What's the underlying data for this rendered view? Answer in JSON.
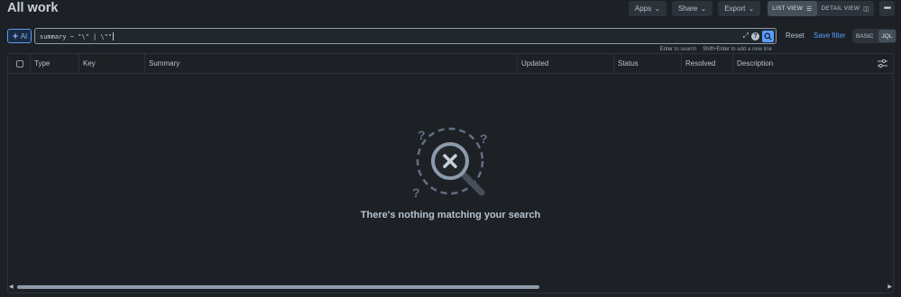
{
  "page": {
    "title": "All work"
  },
  "toolbar": {
    "apps": "Apps",
    "share": "Share",
    "export": "Export",
    "list_view": "LIST VIEW",
    "detail_view": "DETAIL VIEW",
    "more": "•••"
  },
  "search": {
    "ai_label": "AI",
    "query": "summary ~ \"\\\" | \\\"\"",
    "hint_enter_key": "Enter",
    "hint_enter_text": "to search",
    "hint_shift_key": "Shift+Enter",
    "hint_shift_text": "to add a new line",
    "reset": "Reset",
    "save_filter": "Save filter",
    "mode_basic": "BASIC",
    "mode_jql": "JQL"
  },
  "table": {
    "columns": [
      "Type",
      "Key",
      "Summary",
      "Updated",
      "Status",
      "Resolved",
      "Description"
    ]
  },
  "empty_state": {
    "message": "There's nothing matching your search"
  },
  "colors": {
    "accent": "#579dff",
    "background": "#1d2125",
    "surface": "#2c333a"
  },
  "icons": [
    "sparkle-icon",
    "expand-icon",
    "help-icon",
    "search-icon",
    "column-settings-icon",
    "magnifier-x-icon",
    "chevron-down-icon",
    "list-icon",
    "detail-icon"
  ]
}
